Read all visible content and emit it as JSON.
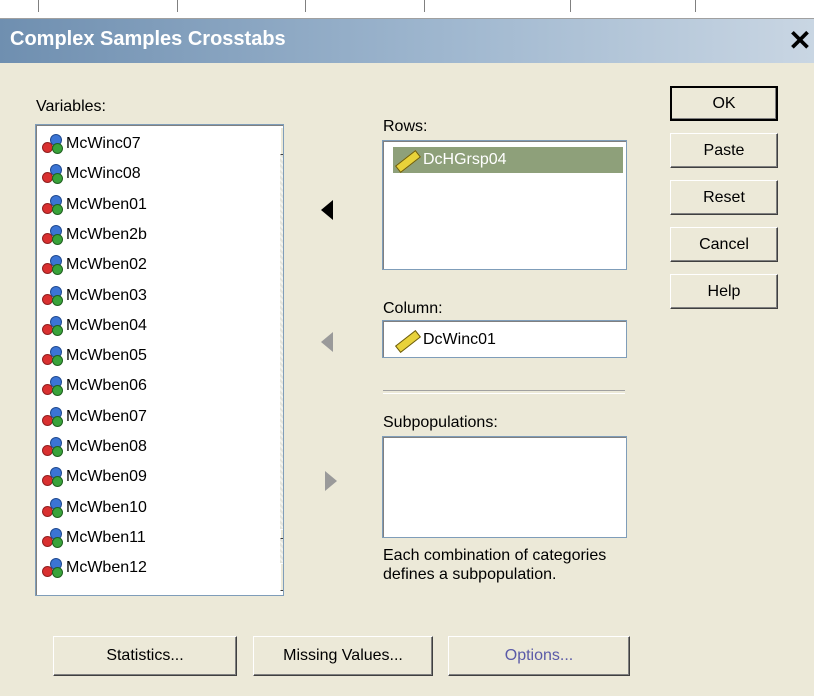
{
  "window": {
    "title": "Complex Samples Crosstabs",
    "close_glyph": "✕"
  },
  "variables": {
    "label": "Variables:",
    "items": [
      "McWinc07",
      "McWinc08",
      "McWben01",
      "McWben2b",
      "McWben02",
      "McWben03",
      "McWben04",
      "McWben05",
      "McWben06",
      "McWben07",
      "McWben08",
      "McWben09",
      "McWben10",
      "McWben11",
      "McWben12"
    ]
  },
  "rows": {
    "label": "Rows:",
    "items": [
      "DcHGrsp04"
    ]
  },
  "column": {
    "label": "Column:",
    "value": "DcWinc01"
  },
  "subpopulations": {
    "label": "Subpopulations:",
    "note_line1": "Each combination of categories",
    "note_line2": "defines a subpopulation."
  },
  "buttons": {
    "ok": "OK",
    "paste": "Paste",
    "reset": "Reset",
    "cancel": "Cancel",
    "help": "Help"
  },
  "bottom_buttons": {
    "statistics": "Statistics...",
    "missing_values": "Missing Values...",
    "options": "Options..."
  },
  "colors": {
    "title_gradient_start": "#6f8fb0",
    "dialog_bg": "#ece9d8",
    "selection": "#8ea07a"
  },
  "icons": {
    "variable": "scale-variable-icon",
    "measure": "ruler-icon"
  }
}
